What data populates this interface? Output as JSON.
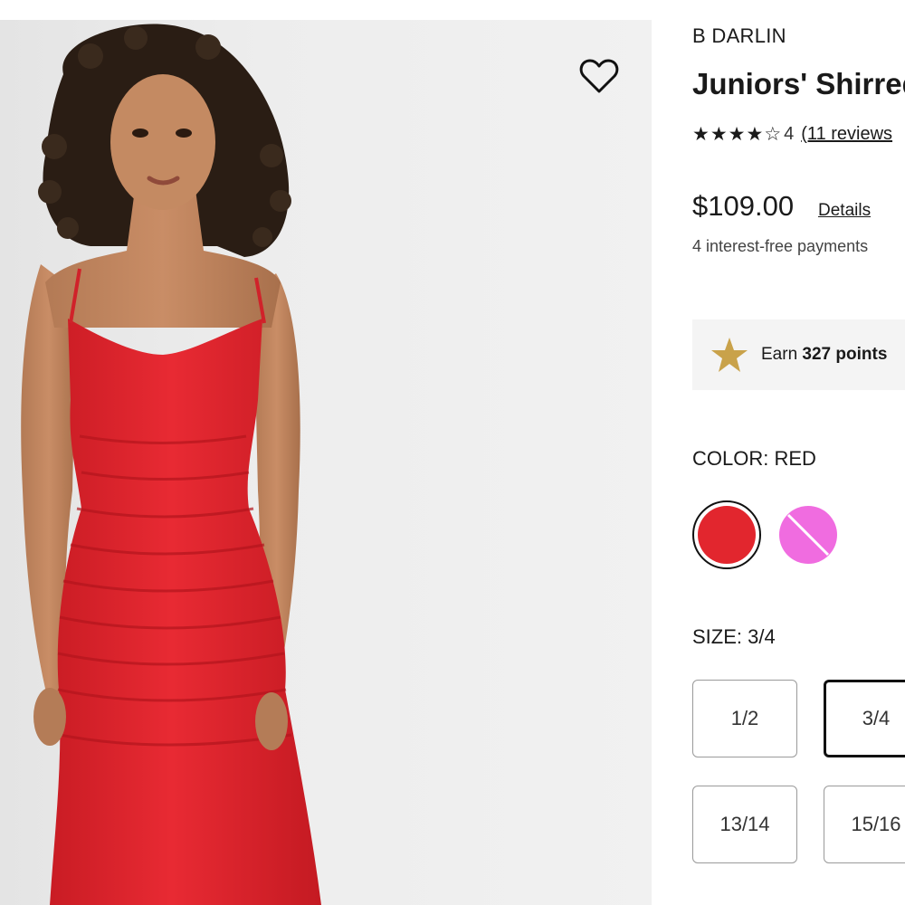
{
  "product": {
    "brand": "B DARLIN",
    "title": "Juniors' Shirred",
    "rating": {
      "stars_filled": 4,
      "stars_total": 5,
      "value": "4",
      "reviews_text": "(11 reviews"
    },
    "price": "$109.00",
    "details_label": "Details",
    "installments_text": "4 interest-free payments",
    "rewards": {
      "prefix": "Earn ",
      "points": "327 points"
    }
  },
  "color": {
    "label": "COLOR: RED",
    "options": [
      {
        "name": "red",
        "hex": "#e2262e",
        "selected": true
      },
      {
        "name": "pink",
        "hex": "#f06ce0",
        "selected": false,
        "unavailable": true
      }
    ]
  },
  "size": {
    "label": "SIZE: 3/4",
    "options": [
      "1/2",
      "3/4",
      "13/14",
      "15/16"
    ],
    "selected": "3/4"
  },
  "icons": {
    "wishlist": "heart-outline-icon",
    "rewards": "gold-star-icon",
    "star_full": "★",
    "star_empty": "☆"
  },
  "colors": {
    "dress": "#e3262f",
    "rewards_star": "#c9a24a",
    "image_background": "#ececec"
  }
}
